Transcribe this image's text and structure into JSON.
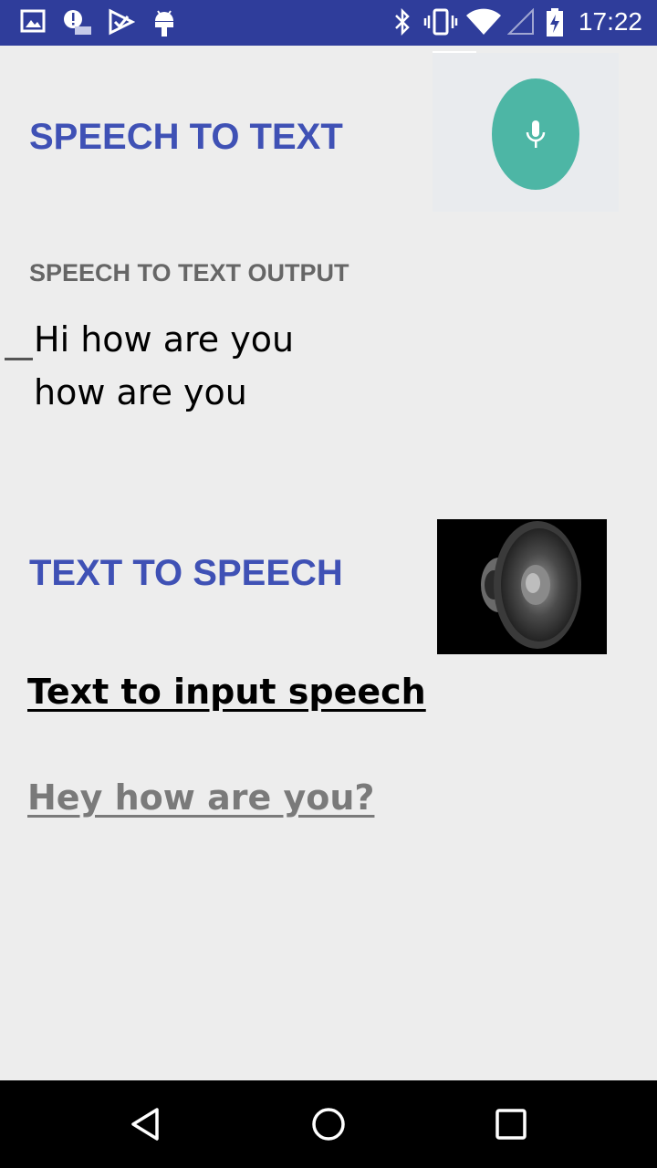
{
  "status_bar": {
    "time": "17:22",
    "left_icons": [
      "image-icon",
      "alert-icon",
      "check-app-icon",
      "android-icon"
    ],
    "right_icons": [
      "bluetooth-icon",
      "vibrate-icon",
      "wifi-icon",
      "signal-icon",
      "battery-charging-icon"
    ],
    "background": "#2f3d9b"
  },
  "speech_to_text": {
    "title": "SPEECH TO TEXT",
    "mic_icon": "mic-icon",
    "output_label": "SPEECH TO TEXT OUTPUT",
    "output_lines": [
      "Hi how are you",
      "how are you"
    ]
  },
  "text_to_speech": {
    "title": "TEXT TO SPEECH",
    "speaker_icon": "speaker-icon",
    "input_label": "Text to input speech",
    "input_value": "Hey how are you?"
  },
  "nav_bar": {
    "buttons": [
      "back-icon",
      "home-icon",
      "recents-icon"
    ]
  },
  "colors": {
    "accent": "#3f51b5",
    "mic_button": "#4db6a5",
    "background": "#ededed"
  }
}
